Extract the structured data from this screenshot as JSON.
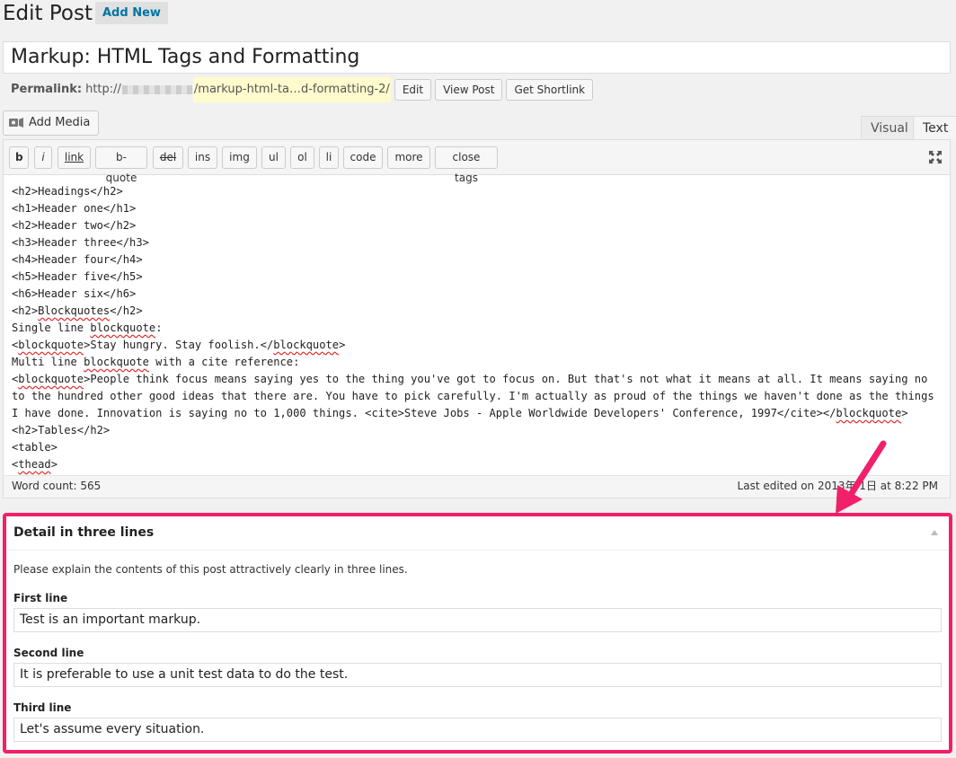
{
  "header": {
    "title": "Edit Post",
    "add_new": "Add New"
  },
  "post": {
    "title": "Markup: HTML Tags and Formatting"
  },
  "permalink": {
    "label": "Permalink:",
    "base": "http://",
    "slug": "/markup-html-ta…d-formatting-2/",
    "edit": "Edit",
    "view_post": "View Post",
    "get_shortlink": "Get Shortlink"
  },
  "editor": {
    "add_media": "Add Media",
    "tabs": {
      "visual": "Visual",
      "text": "Text"
    },
    "quicktags": [
      "b",
      "i",
      "link",
      "b-quote",
      "del",
      "ins",
      "img",
      "ul",
      "ol",
      "li",
      "code",
      "more",
      "close tags"
    ],
    "lines": {
      "l1": "<h2>Headings</h2>",
      "l2": "<h1>Header one</h1>",
      "l3": "<h2>Header two</h2>",
      "l4": "<h3>Header three</h3>",
      "l5": "<h4>Header four</h4>",
      "l6": "<h5>Header five</h5>",
      "l7": "<h6>Header six</h6>",
      "l8a": "<h2>",
      "l8b": "Blockquotes",
      "l8c": "</h2>",
      "l9a": "Single line ",
      "l9b": "blockquote",
      "l9c": ":",
      "l10a": "<",
      "l10b": "blockquote",
      "l10c": ">Stay hungry. Stay foolish.</",
      "l10d": "blockquote",
      "l10e": ">",
      "l11a": "Multi line ",
      "l11b": "blockquote",
      "l11c": " with a cite reference:",
      "l12a": "<",
      "l12b": "blockquote",
      "l12c": ">People think focus means saying yes to the thing you've got to focus on. But that's not what it means at all. It means saying no to the hundred other good ideas that there are. You have to pick carefully. I'm actually as proud of the things we haven't done as the things I have done. Innovation is saying no to 1,000 things. <cite>Steve Jobs - Apple Worldwide Developers' Conference, 1997</cite></",
      "l12d": "blockquote",
      "l12e": ">",
      "l13": "<h2>Tables</h2>",
      "l14": "<table>",
      "l15a": "<",
      "l15b": "thead",
      "l15c": ">"
    },
    "word_count": "Word count: 565",
    "last_edited": "Last edited on 2013年   1日 at 8:22 PM"
  },
  "metabox": {
    "title": "Detail in three lines",
    "description": "Please explain the contents of this post attractively clearly in three lines.",
    "fields": [
      {
        "label": "First line",
        "value": "Test is an important markup."
      },
      {
        "label": "Second line",
        "value": "It is preferable to use a unit test data to do the test."
      },
      {
        "label": "Third line",
        "value": "Let's assume every situation."
      }
    ]
  },
  "colors": {
    "highlight_border": "#f1206a",
    "link": "#0074a2",
    "slug_highlight": "#fffbcc"
  }
}
